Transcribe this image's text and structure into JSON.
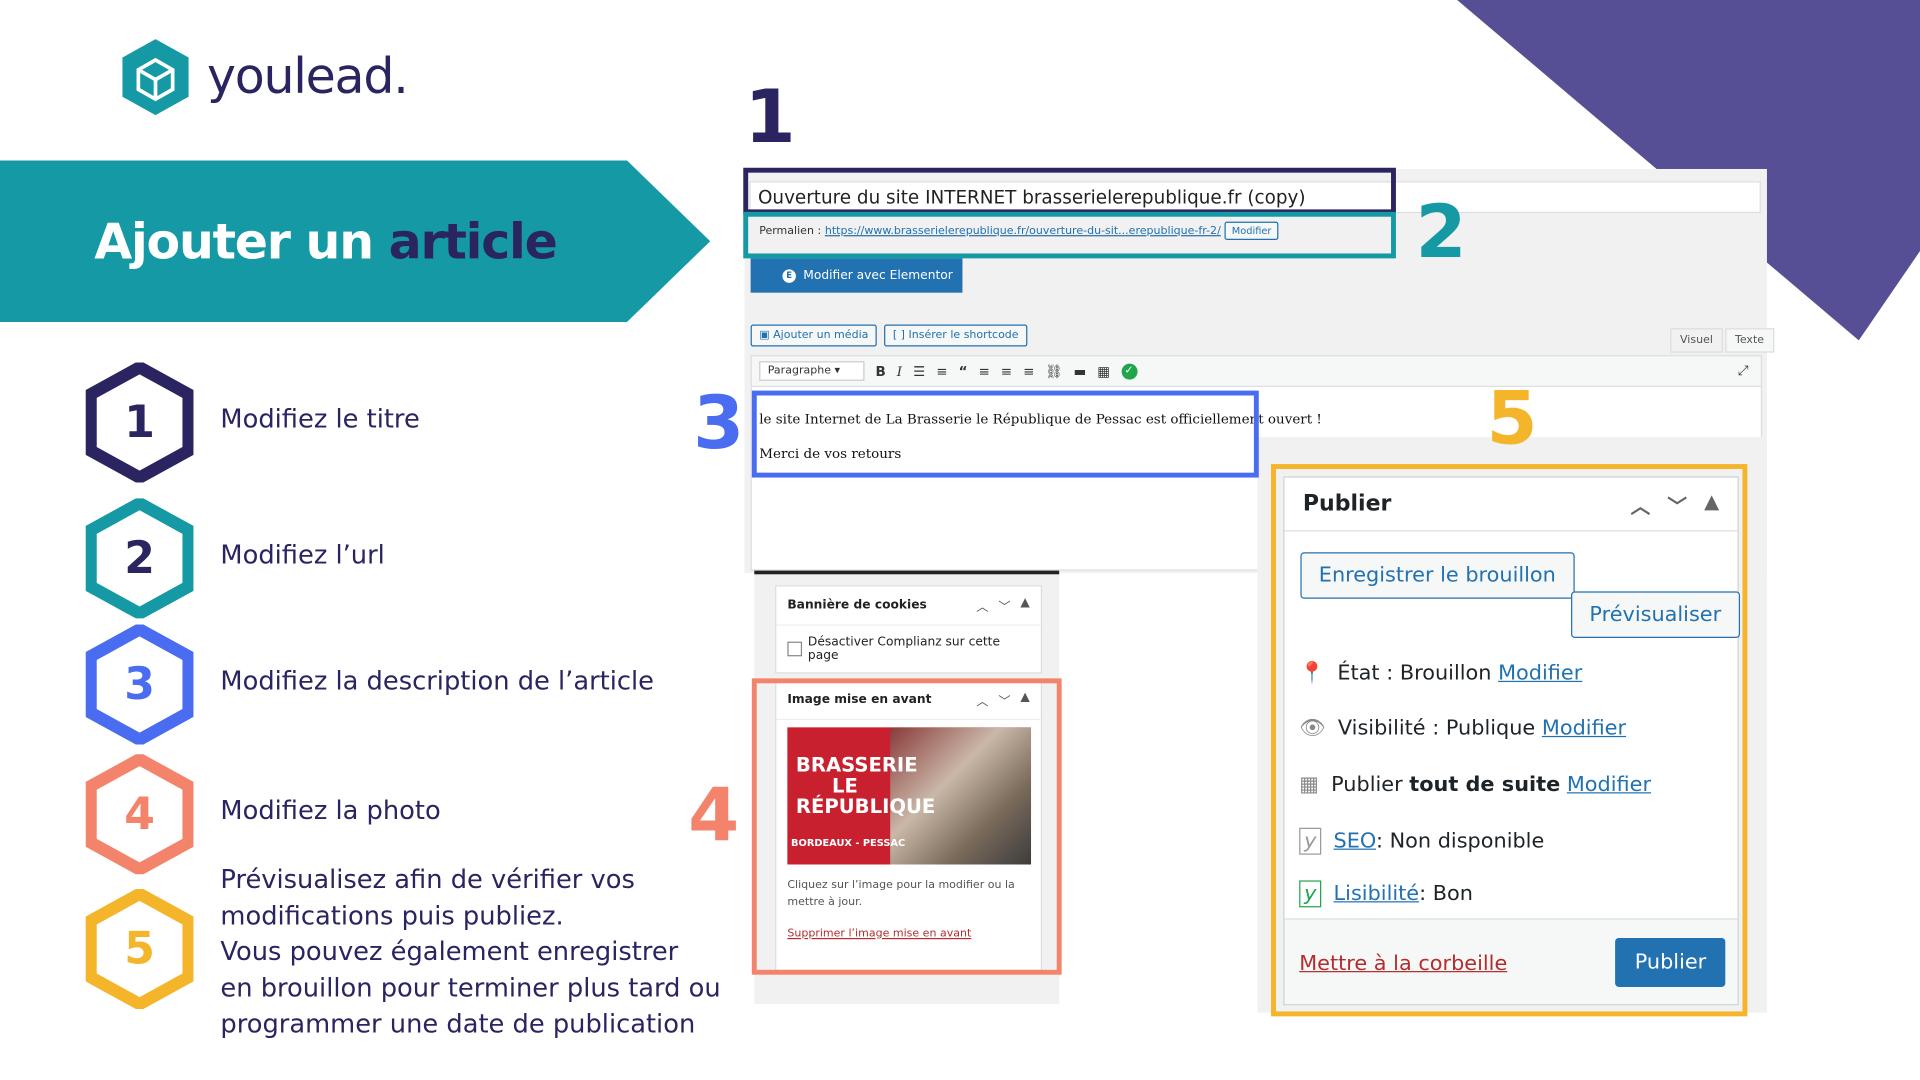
{
  "brand": {
    "name": "youlead."
  },
  "banner": {
    "title_part1": "Ajouter un",
    "title_part2": "article"
  },
  "steps": [
    {
      "num": "1",
      "text": "Modifiez le titre",
      "color": "#2a2560"
    },
    {
      "num": "2",
      "text": "Modifiez l’url",
      "color": "#159aa5"
    },
    {
      "num": "3",
      "text": "Modifiez la description de l’article",
      "color": "#4a6cf0"
    },
    {
      "num": "4",
      "text": "Modifiez la photo",
      "color": "#f4836b"
    },
    {
      "num": "5",
      "text_lines": [
        "Prévisualisez afin de vérifier vos",
        "modifications puis publiez.",
        "Vous pouvez également enregistrer",
        "en brouillon pour terminer plus tard ou",
        "programmer une date de publication"
      ],
      "color": "#f5b52a"
    }
  ],
  "callouts": {
    "n1": "1",
    "n2": "2",
    "n3": "3",
    "n4": "4",
    "n5": "5"
  },
  "editor": {
    "post_title": "Ouverture du site INTERNET brasserielerepublique.fr (copy)",
    "permalink_label": "Permalien :",
    "permalink_url": "https://www.brasserielerepublique.fr/ouverture-du-sit...erepublique-fr-2/",
    "permalink_edit": "Modifier",
    "elementor_button": "Modifier avec Elementor",
    "add_media": "Ajouter un média",
    "insert_shortcode": "Insérer le shortcode",
    "tab_visual": "Visuel",
    "tab_text": "Texte",
    "paragraph_select": "Paragraphe",
    "content_line1": "le site Internet de La Brasserie le République de Pessac est officiellement ouvert !",
    "content_line2": "Merci de vos retours"
  },
  "cookie_box": {
    "title": "Bannière de cookies",
    "checkbox_label": "Désactiver Complianz sur cette page"
  },
  "image_box": {
    "title": "Image mise en avant",
    "image_text_line1": "BRASSERIE",
    "image_text_line2": "LE",
    "image_text_line3": "RÉPUBLIQUE",
    "image_subtext": "BORDEAUX - PESSAC",
    "hint": "Cliquez sur l’image pour la modifier ou la mettre à jour.",
    "remove_link": "Supprimer l’image mise en avant"
  },
  "publish_box": {
    "title": "Publier",
    "save_draft": "Enregistrer le brouillon",
    "preview": "Prévisualiser",
    "status_label": "État :",
    "status_value": "Brouillon",
    "visibility_label": "Visibilité :",
    "visibility_value": "Publique",
    "schedule_label": "Publier",
    "schedule_value": "tout de suite",
    "edit_link": "Modifier",
    "seo_link": "SEO",
    "seo_value": ": Non disponible",
    "readability_link": "Lisibilité",
    "readability_value": ": Bon",
    "trash": "Mettre à la corbeille",
    "publish": "Publier"
  },
  "colors": {
    "navy": "#2a2560",
    "teal": "#159aa5",
    "blue": "#4a6cf0",
    "salmon": "#f4836b",
    "yellow": "#f5b52a",
    "purple": "#574f95",
    "wp_blue": "#2271b1"
  }
}
